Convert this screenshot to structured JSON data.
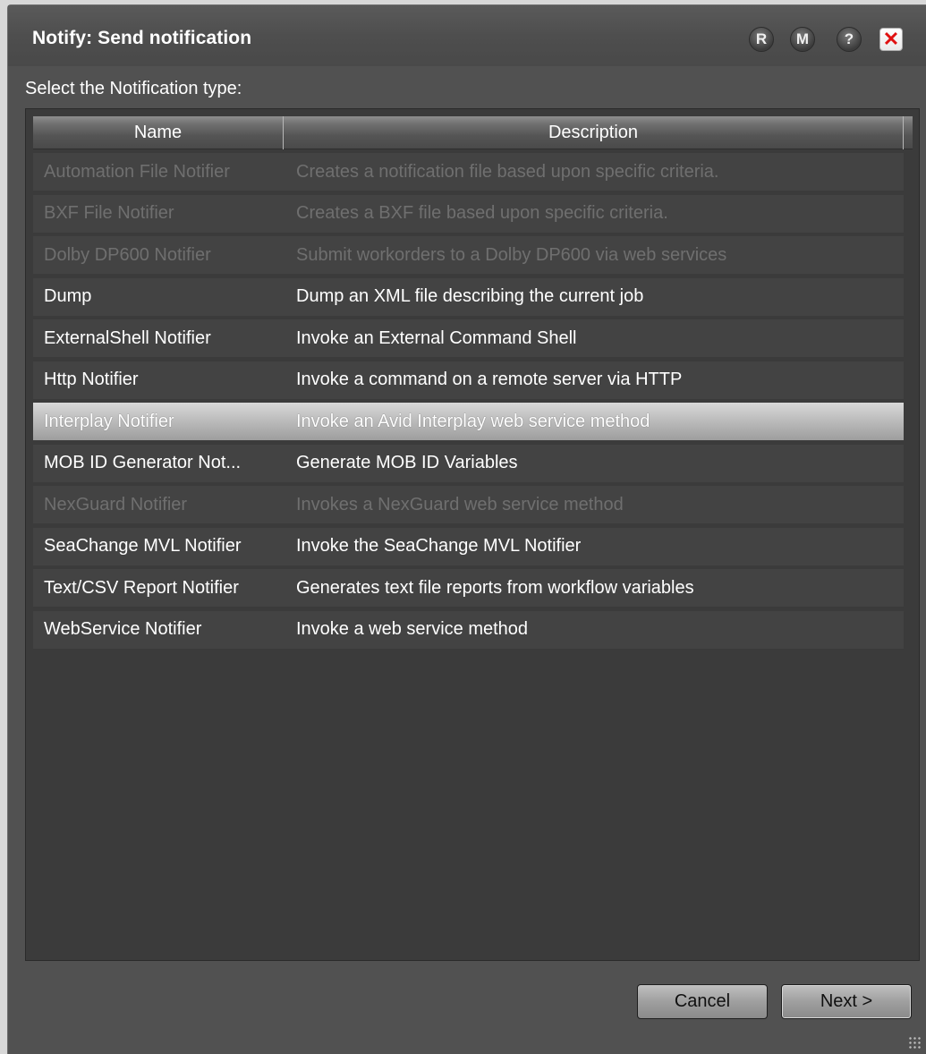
{
  "window": {
    "title": "Notify: Send notification",
    "buttons": {
      "r": "R",
      "m": "M",
      "help": "?",
      "close": "✕"
    }
  },
  "prompt": "Select the Notification type:",
  "table": {
    "columns": {
      "name": "Name",
      "description": "Description"
    },
    "rows": [
      {
        "name": "Automation File Notifier",
        "description": "Creates a notification file based upon specific criteria.",
        "enabled": false
      },
      {
        "name": "BXF File Notifier",
        "description": "Creates a BXF file based upon specific criteria.",
        "enabled": false
      },
      {
        "name": "Dolby DP600 Notifier",
        "description": "Submit workorders to a Dolby DP600 via web services",
        "enabled": false
      },
      {
        "name": "Dump",
        "description": "Dump an XML file describing the current job",
        "enabled": true
      },
      {
        "name": "ExternalShell Notifier",
        "description": "Invoke an External Command Shell",
        "enabled": true
      },
      {
        "name": "Http Notifier",
        "description": "Invoke a command on a remote server via HTTP",
        "enabled": true
      },
      {
        "name": "Interplay Notifier",
        "description": "Invoke an Avid Interplay web service method",
        "enabled": true,
        "selected": true
      },
      {
        "name": "MOB ID Generator Not...",
        "description": "Generate MOB ID Variables",
        "enabled": true
      },
      {
        "name": "NexGuard Notifier",
        "description": "Invokes a NexGuard web service method",
        "enabled": false
      },
      {
        "name": "SeaChange MVL Notifier",
        "description": "Invoke the SeaChange MVL Notifier",
        "enabled": true
      },
      {
        "name": "Text/CSV Report Notifier",
        "description": "Generates text file reports from workflow variables",
        "enabled": true
      },
      {
        "name": "WebService Notifier",
        "description": "Invoke a web service method",
        "enabled": true
      }
    ]
  },
  "footer": {
    "cancel_label": "Cancel",
    "next_label": "Next >"
  }
}
